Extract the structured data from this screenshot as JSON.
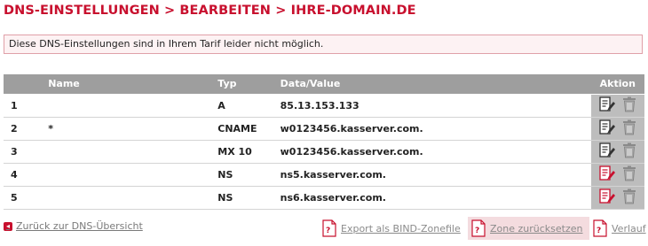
{
  "breadcrumb": {
    "part1": "DNS-EINSTELLUNGEN",
    "sep1": ">",
    "part2": "BEARBEITEN",
    "sep2": ">",
    "part3": "IHRE-DOMAIN.DE"
  },
  "error_message": "Diese DNS-Einstellungen sind in Ihrem Tarif leider nicht möglich.",
  "table": {
    "headers": {
      "nr": "",
      "name": "Name",
      "typ": "Typ",
      "data": "Data/Value",
      "action": "Aktion"
    },
    "rows": [
      {
        "nr": "1",
        "name": "",
        "typ": "A",
        "data": "85.13.153.133",
        "edit_icon": "edit-icon",
        "edit_highlight": false
      },
      {
        "nr": "2",
        "name": "*",
        "typ": "CNAME",
        "data": "w0123456.kasserver.com.",
        "edit_icon": "edit-icon",
        "edit_highlight": false
      },
      {
        "nr": "3",
        "name": "",
        "typ": "MX 10",
        "data": "w0123456.kasserver.com.",
        "edit_icon": "edit-icon",
        "edit_highlight": false
      },
      {
        "nr": "4",
        "name": "",
        "typ": "NS",
        "data": "ns5.kasserver.com.",
        "edit_icon": "edit-icon",
        "edit_highlight": true
      },
      {
        "nr": "5",
        "name": "",
        "typ": "NS",
        "data": "ns6.kasserver.com.",
        "edit_icon": "edit-icon",
        "edit_highlight": true
      }
    ]
  },
  "footer": {
    "back_label": "Zurück zur DNS-Übersicht",
    "export_label": "Export als BIND-Zonefile",
    "reset_label": "Zone zurücksetzen",
    "history_label": "Verlauf"
  },
  "colors": {
    "brand_red": "#c8102e",
    "header_gray": "#9e9e9e",
    "action_gray": "#bdbdbd"
  }
}
